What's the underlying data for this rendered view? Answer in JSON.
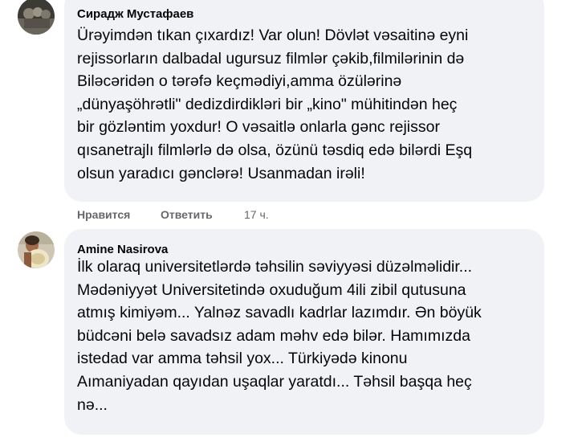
{
  "comments": [
    {
      "author": "Сирадж Мустафаев",
      "avatar": "profile-photo",
      "lines": [
        "Ürəyimdən tıkan çıxardız! Var olun! Dövlət vəsaitinə eyni",
        "rejissorların dalbadal ugursuz filmlər çəkib,filmilərinin də",
        "Biləcəridən o tərəfə keçmədiyi,amma özülərinə",
        "„dünyaşöhrətli\" dedizdirdikləri bir „kino\" mühitindən heç",
        "bir gözləntim yoxdur! O vəsaitlə onlarla gənc rejissor",
        "qısanetrajlı filmlərlə də olsa, özünü təsdiq edə bilərdi Eşq",
        "olsun yaradıcı gənclərə! Usanmadan irəli!"
      ],
      "actions": {
        "like": "Нравится",
        "reply": "Ответить",
        "time": "17 ч."
      }
    },
    {
      "author": "Amine Nasirova",
      "avatar": "profile-photo",
      "lines": [
        "İlk olaraq universitetlərdə təhsilin səviyyəsi düzəlməlidir...",
        "Mədəniyyət Universitetində oxuduğum 4ili zibil qutusuna",
        "atmış kimiyəm... Yalnəz savadlı kadrlar lazımdır. Ən böyük",
        "büdcəni belə savadsız adam məhv edə bilər. Hamımızda",
        "istedad var amma təhsil yox... Türkiyədə kinonu",
        "Aımaniyadan qayıdan uşaqlar yaratdı... Təhsil başqa heç",
        "nə..."
      ]
    }
  ]
}
